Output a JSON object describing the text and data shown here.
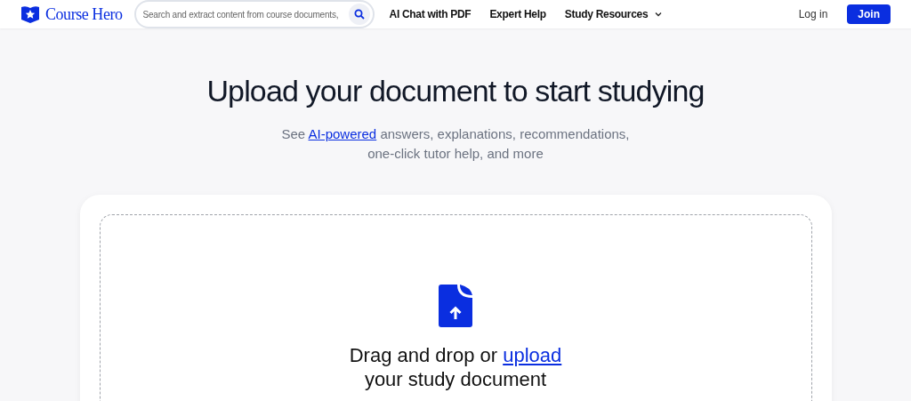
{
  "header": {
    "logo": "Course Hero",
    "search": {
      "placeholder": "Search and extract content from course documents,"
    },
    "nav": [
      {
        "label": "AI Chat with PDF",
        "kind": "link"
      },
      {
        "label": "Expert Help",
        "kind": "link"
      },
      {
        "label": "Study Resources",
        "kind": "dropdown"
      }
    ],
    "login": "Log in",
    "join": "Join"
  },
  "hero": {
    "title": "Upload your document to start studying",
    "subtitle": {
      "before": "See",
      "link": "AI-powered",
      "after": "answers, explanations, recommendations,",
      "line2": "one-click tutor help, and more"
    }
  },
  "dropzone": {
    "text": "Drag and drop or",
    "link": "upload",
    "line2": "your study document"
  }
}
